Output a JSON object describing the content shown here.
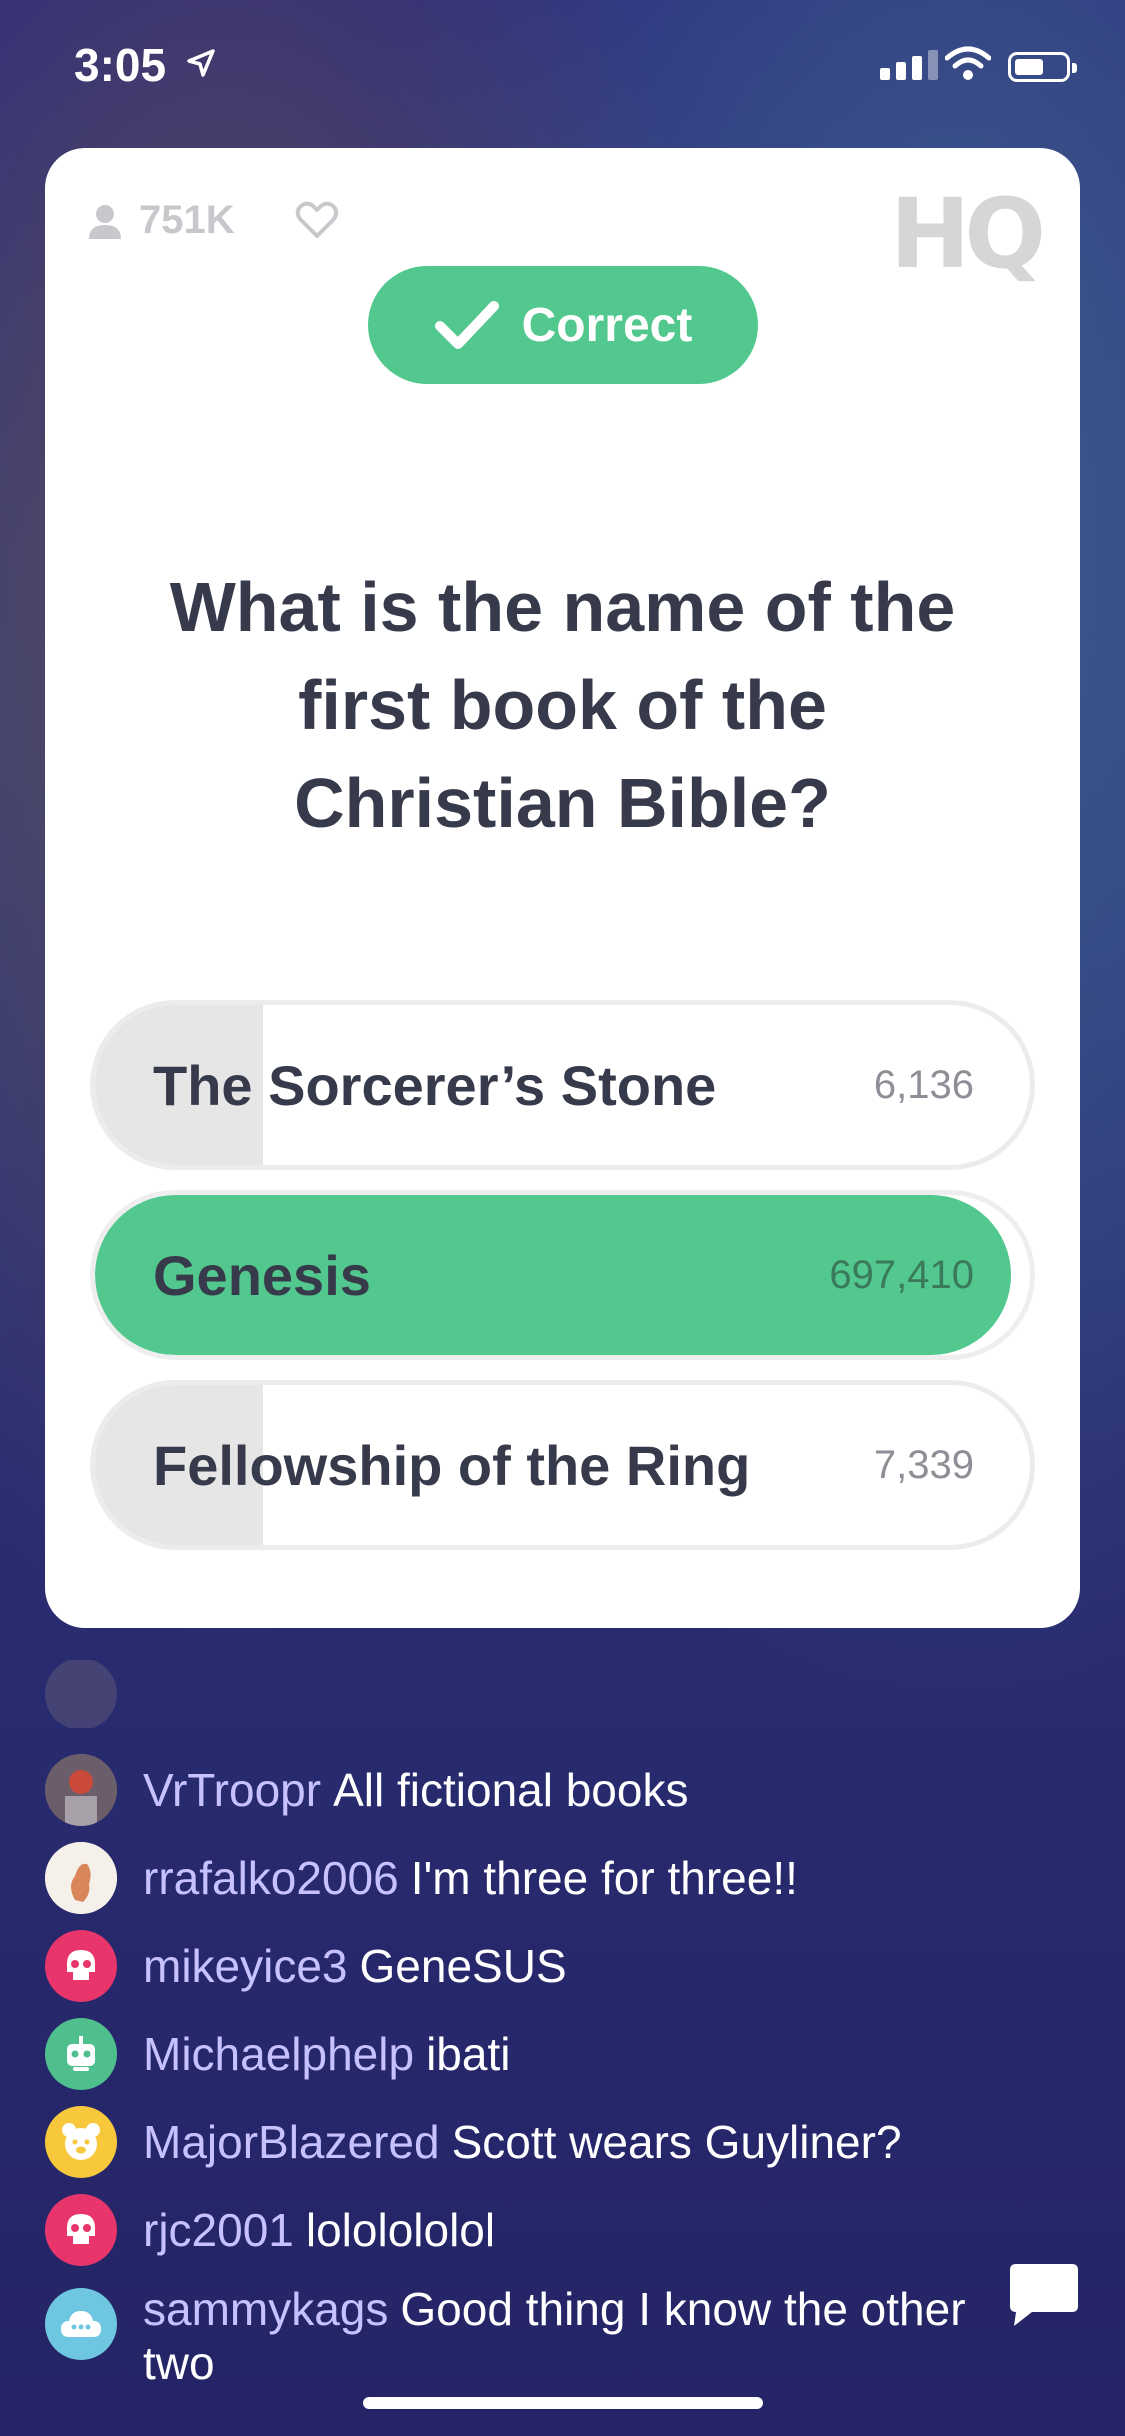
{
  "status_bar": {
    "time": "3:05"
  },
  "card": {
    "viewers": "751K",
    "logo": "HQ",
    "result": "Correct",
    "question": [
      "What is the name of the",
      "first book of the",
      "Christian Bible?"
    ],
    "answers": [
      {
        "label": "The Sorcerer’s Stone",
        "count": "6,136",
        "share": 0.18,
        "correct": false
      },
      {
        "label": "Genesis",
        "count": "697,410",
        "share": 0.98,
        "correct": true
      },
      {
        "label": "Fellowship of the Ring",
        "count": "7,339",
        "share": 0.18,
        "correct": false
      }
    ]
  },
  "chat": {
    "messages": [
      {
        "user": "VrTroopr",
        "text": "All fictional books",
        "avatar_color": "#8a6a6a"
      },
      {
        "user": "rrafalko2006",
        "text": "I'm three for three!!",
        "avatar_color": "#f3eee8"
      },
      {
        "user": "mikeyice3",
        "text": "GeneSUS",
        "avatar_color": "#e8356c"
      },
      {
        "user": "Michaelphelp",
        "text": "ibati",
        "avatar_color": "#4fc08d"
      },
      {
        "user": "MajorBlazered",
        "text": "Scott wears Guyliner?",
        "avatar_color": "#f7c83c"
      },
      {
        "user": "rjc2001",
        "text": "lololololol",
        "avatar_color": "#e8356c"
      },
      {
        "user": "sammykags",
        "text": "Good thing I know the other two",
        "avatar_color": "#6ec6e0"
      }
    ]
  },
  "colors": {
    "accent_green": "#52c88f",
    "text_dark": "#373a4a",
    "username": "#c7c2ff"
  }
}
